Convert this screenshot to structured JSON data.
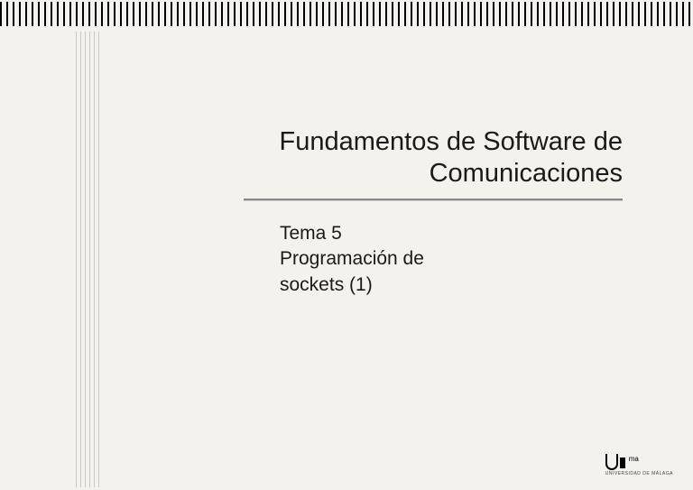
{
  "title": {
    "line1": "Fundamentos de Software de",
    "line2": "Comunicaciones"
  },
  "body": {
    "topic_label": "Tema 5",
    "topic_text_line1": "Programación de",
    "topic_text_line2": "sockets (1)"
  },
  "logo": {
    "suffix": "ma",
    "subtext": "UNIVERSIDAD DE MÁLAGA"
  }
}
